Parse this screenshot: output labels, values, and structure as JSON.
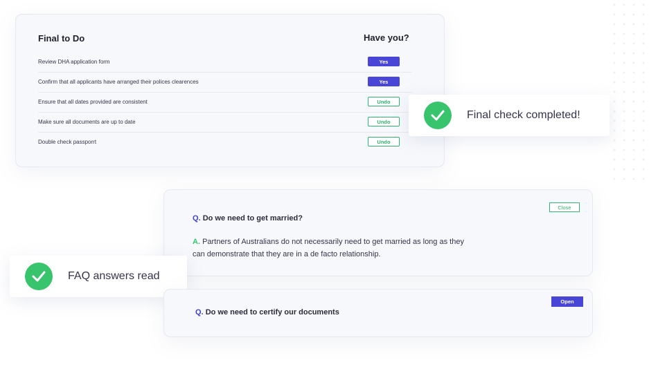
{
  "todo": {
    "title": "Final to Do",
    "column_header": "Have you?",
    "items": [
      {
        "label": "Review DHA application form",
        "button": "Yes",
        "state": "yes"
      },
      {
        "label": "Confirm that all applicants have arranged their polices clearences",
        "button": "Yes",
        "state": "yes"
      },
      {
        "label": "Ensure that all dates provided are consistent",
        "button": "Undo",
        "state": "undo"
      },
      {
        "label": "Make sure all documents are up to date",
        "button": "Undo",
        "state": "undo"
      },
      {
        "label": "Double check passporrt",
        "button": "Undo",
        "state": "undo"
      }
    ]
  },
  "toasts": {
    "final": {
      "text": "Final check completed!",
      "icon": "check-circle-icon"
    },
    "faq": {
      "text": "FAQ answers read",
      "icon": "check-circle-icon"
    }
  },
  "faq": {
    "q_marker": "Q.",
    "a_marker": "A.",
    "items": [
      {
        "question": "Do we need to get married?",
        "answer": "Partners of Australians do not necessarily need to get married as long as they can demonstrate that they are in a de facto relationship.",
        "button": "Close"
      },
      {
        "question": "Do we need to certify our documents",
        "button": "Open"
      }
    ]
  },
  "colors": {
    "accent": "#4945d6",
    "success": "#38c46d",
    "question_marker": "#3a43c9"
  }
}
